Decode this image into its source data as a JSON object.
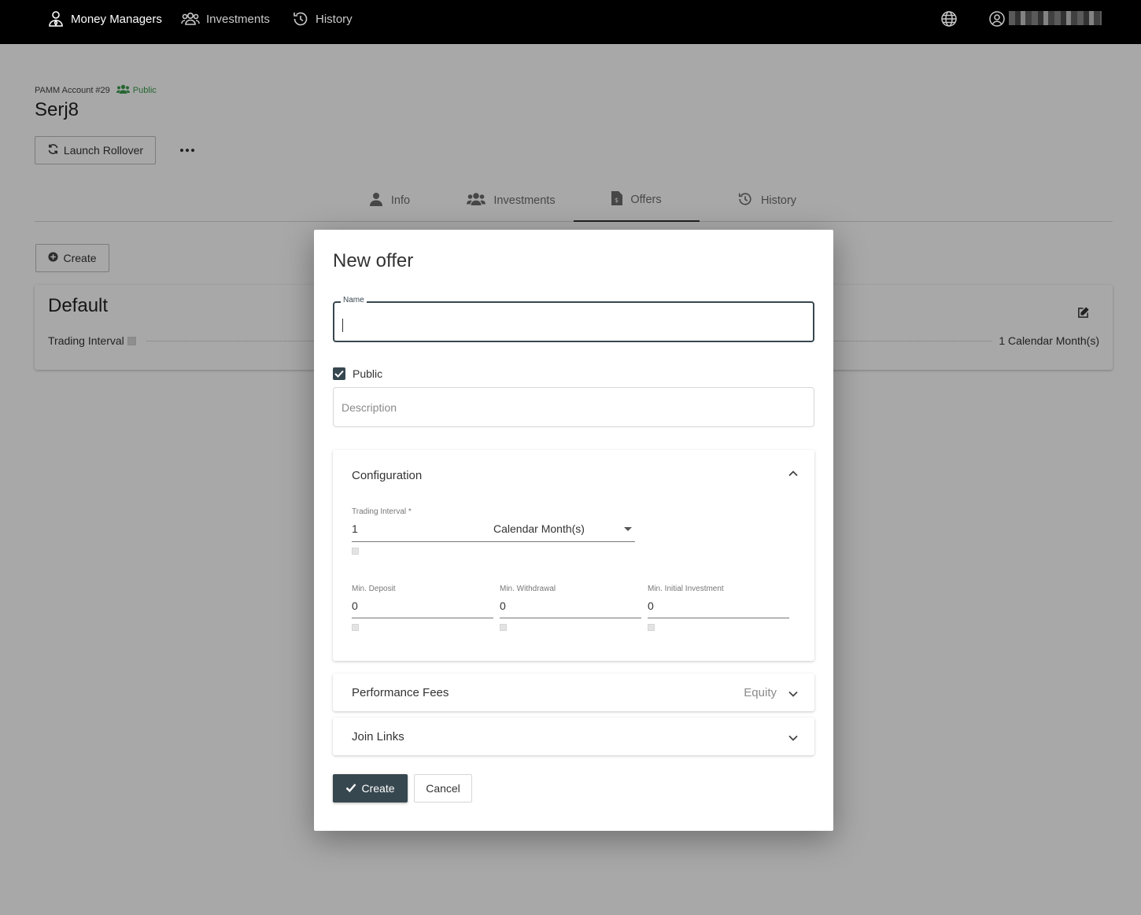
{
  "topnav": {
    "items": [
      {
        "label": "Money Managers",
        "icon": "user-tie-icon",
        "active": true
      },
      {
        "label": "Investments",
        "icon": "users-icon",
        "active": false
      },
      {
        "label": "History",
        "icon": "history-icon",
        "active": false
      }
    ],
    "globe_icon": "globe-icon",
    "user_icon": "user-circle-icon"
  },
  "account": {
    "label": "PAMM Account #29",
    "visibility": "Public",
    "title": "Serj8",
    "rollover_label": "Launch Rollover"
  },
  "tabs": [
    {
      "label": "Info",
      "icon": "user-icon",
      "active": false
    },
    {
      "label": "Investments",
      "icon": "users-icon",
      "active": false
    },
    {
      "label": "Offers",
      "icon": "document-dollar-icon",
      "active": true
    },
    {
      "label": "History",
      "icon": "history-icon",
      "active": false
    }
  ],
  "offers_page": {
    "create_label": "Create",
    "card": {
      "name": "Default",
      "interval_label": "Trading Interval",
      "interval_value": "1 Calendar Month(s)"
    }
  },
  "modal": {
    "title": "New offer",
    "name_label": "Name",
    "name_value": "",
    "public_label": "Public",
    "public_checked": true,
    "description_placeholder": "Description",
    "configuration": {
      "title": "Configuration",
      "expanded": true,
      "trading_interval_label": "Trading Interval *",
      "trading_interval_value": "1",
      "trading_interval_unit": "Calendar Month(s)",
      "min_deposit_label": "Min. Deposit",
      "min_deposit_value": "0",
      "min_withdrawal_label": "Min. Withdrawal",
      "min_withdrawal_value": "0",
      "min_initial_investment_label": "Min. Initial Investment",
      "min_initial_investment_value": "0"
    },
    "performance_fees": {
      "title": "Performance Fees",
      "side_label": "Equity"
    },
    "join_links": {
      "title": "Join Links"
    },
    "create_label": "Create",
    "cancel_label": "Cancel"
  },
  "colors": {
    "nav_bg": "#000000",
    "primary": "#37474f",
    "public_green": "#3b9c4c",
    "overlay": "rgba(0,0,0,0.34)"
  }
}
